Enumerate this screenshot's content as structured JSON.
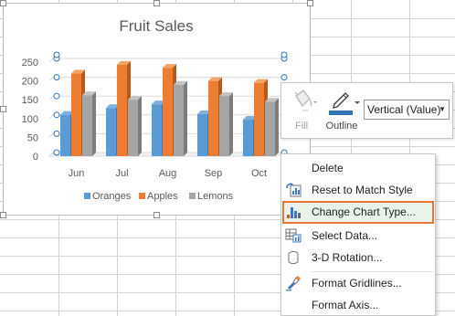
{
  "chart": {
    "title": "Fruit Sales",
    "legend": [
      "Oranges",
      "Apples",
      "Lemons"
    ],
    "colors": {
      "oranges": "#5b9bd5",
      "apples": "#ed7d31",
      "lemons": "#a5a5a5"
    }
  },
  "chart_data": {
    "type": "bar",
    "title": "Fruit Sales",
    "categories": [
      "Jun",
      "Jul",
      "Aug",
      "Sep",
      "Oct"
    ],
    "series": [
      {
        "name": "Oranges",
        "values": [
          110,
          128,
          138,
          112,
          97
        ]
      },
      {
        "name": "Apples",
        "values": [
          220,
          243,
          235,
          200,
          195
        ]
      },
      {
        "name": "Lemons",
        "values": [
          162,
          150,
          190,
          160,
          145
        ]
      }
    ],
    "y_ticks": [
      "0",
      "50",
      "100",
      "150",
      "200",
      "250"
    ],
    "ylim": [
      0,
      250
    ],
    "gridlines": true,
    "legend_position": "bottom",
    "style": "3-D clustered column"
  },
  "mini_toolbar": {
    "fill_label": "Fill",
    "outline_label": "Outline",
    "element_selector": "Vertical (Value)"
  },
  "context_menu": {
    "items": [
      {
        "label": "Delete"
      },
      {
        "label": "Reset to Match Style"
      },
      {
        "label": "Change Chart Type..."
      },
      {
        "label": "Select Data..."
      },
      {
        "label": "3-D Rotation..."
      },
      {
        "label": "Format Gridlines..."
      },
      {
        "label": "Format Axis..."
      }
    ]
  }
}
